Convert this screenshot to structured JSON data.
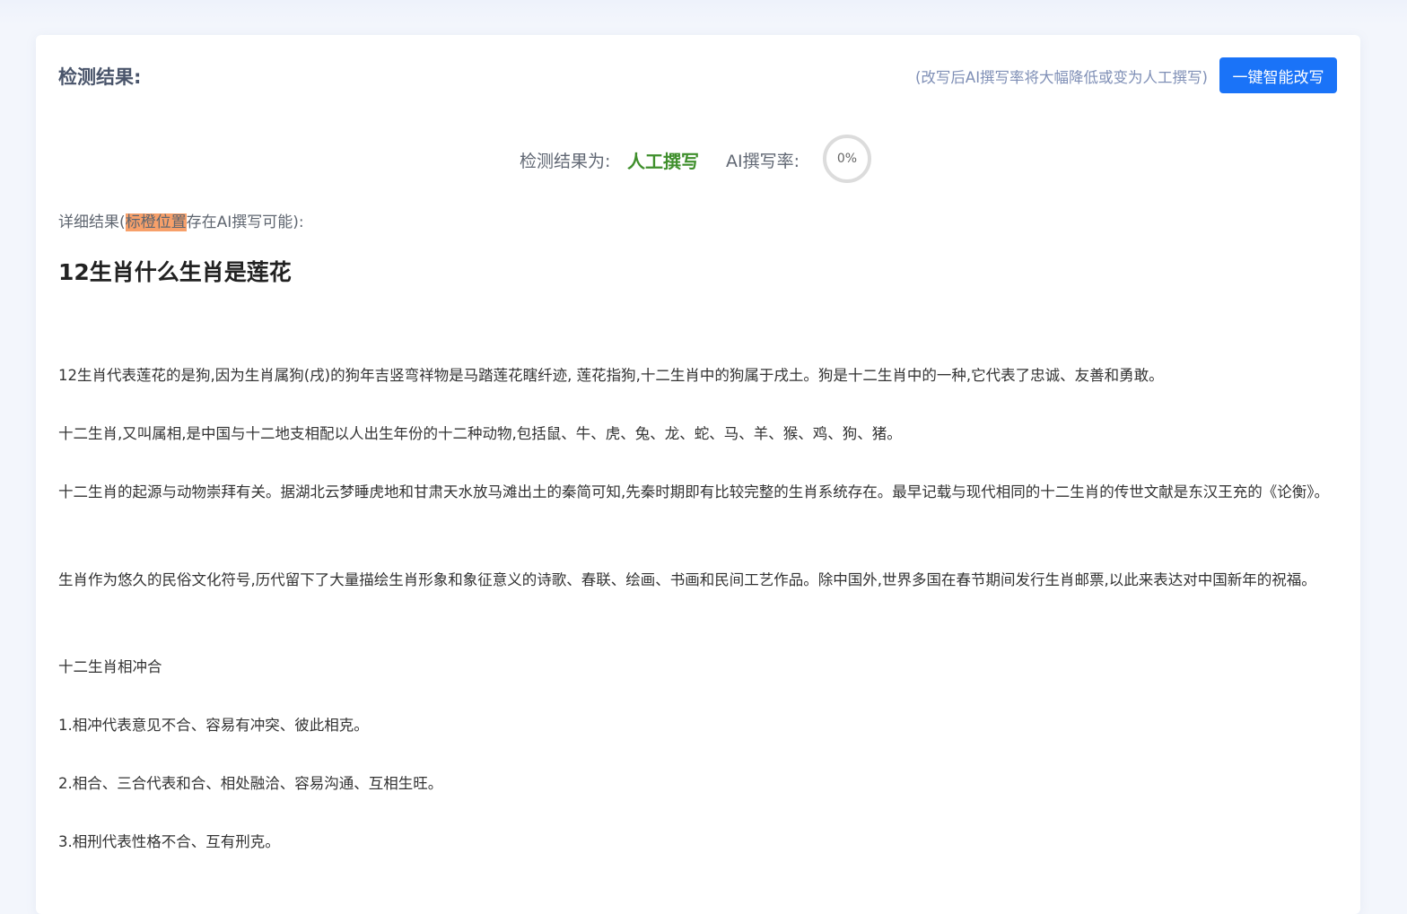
{
  "header": {
    "title": "检测结果:",
    "rewrite_hint": "(改写后AI撰写率将大幅降低或变为人工撰写)",
    "rewrite_button": "一键智能改写"
  },
  "result": {
    "label": "检测结果为:",
    "value": "人工撰写",
    "rate_label": "AI撰写率:",
    "rate_value": "0%",
    "rate_fraction": 0
  },
  "detail": {
    "prefix": "详细结果(",
    "highlight": "标橙位置",
    "suffix": "存在AI撰写可能):"
  },
  "article": {
    "title": "12生肖什么生肖是莲花",
    "paragraphs": [
      "12生肖代表莲花的是狗,因为生肖属狗(戌)的狗年吉竖弯祥物是马踏莲花瞎纤迹, 莲花指狗,十二生肖中的狗属于戌土。狗是十二生肖中的一种,它代表了忠诚、友善和勇敢。",
      "十二生肖,又叫属相,是中国与十二地支相配以人出生年份的十二种动物,包括鼠、牛、虎、兔、龙、蛇、马、羊、猴、鸡、狗、猪。",
      "十二生肖的起源与动物崇拜有关。据湖北云梦睡虎地和甘肃天水放马滩出土的秦简可知,先秦时期即有比较完整的生肖系统存在。最早记载与现代相同的十二生肖的传世文献是东汉王充的《论衡》。",
      "生肖作为悠久的民俗文化符号,历代留下了大量描绘生肖形象和象征意义的诗歌、春联、绘画、书画和民间工艺作品。除中国外,世界多国在春节期间发行生肖邮票,以此来表达对中国新年的祝福。",
      "十二生肖相冲合",
      "1.相冲代表意见不合、容易有冲突、彼此相克。",
      "2.相合、三合代表和合、相处融洽、容易沟通、互相生旺。",
      "3.相刑代表性格不合、互有刑克。"
    ]
  }
}
